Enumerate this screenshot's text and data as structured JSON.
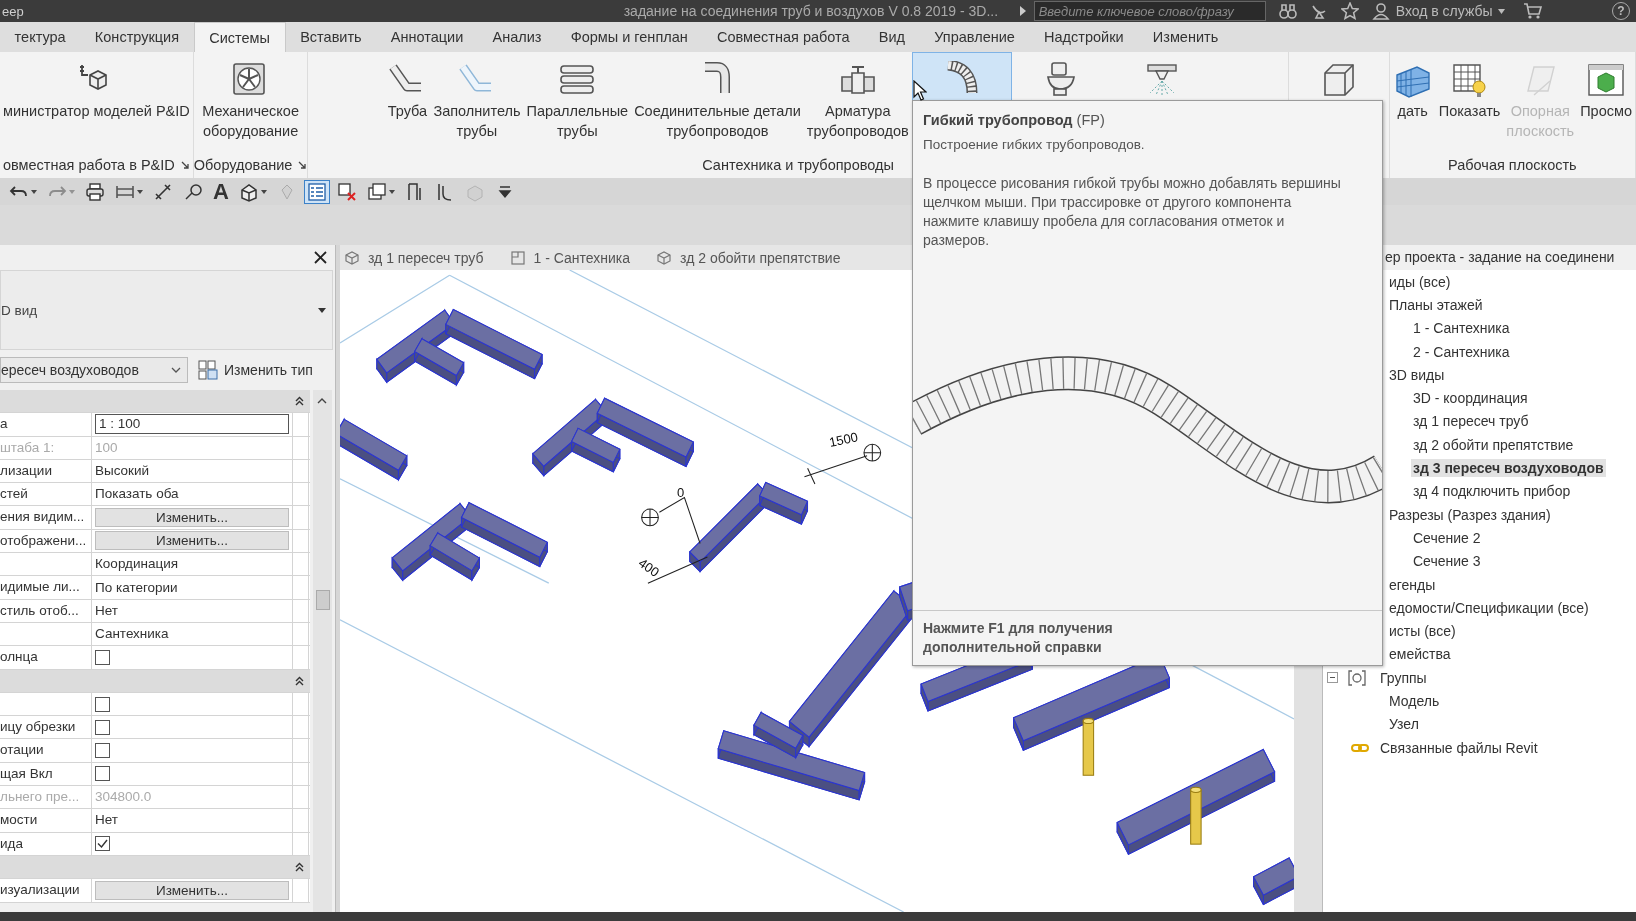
{
  "title_bar": {
    "app_name": "eep",
    "document_title": "задание на соединения труб и воздухов V 0.8  2019 - 3D...",
    "search": {
      "placeholder": "Введите ключевое слово/фразу"
    },
    "sign_in": "Вход в службы",
    "help": "?"
  },
  "ribbon_tabs": [
    {
      "label": "тектура",
      "selected": false
    },
    {
      "label": "Конструкция",
      "selected": false
    },
    {
      "label": "Системы",
      "selected": true
    },
    {
      "label": "Вставить",
      "selected": false
    },
    {
      "label": "Аннотации",
      "selected": false
    },
    {
      "label": "Анализ",
      "selected": false
    },
    {
      "label": "Формы и генплан",
      "selected": false
    },
    {
      "label": "Совместная работа",
      "selected": false
    },
    {
      "label": "Вид",
      "selected": false
    },
    {
      "label": "Управление",
      "selected": false
    },
    {
      "label": "Надстройки",
      "selected": false
    },
    {
      "label": "Изменить",
      "selected": false
    }
  ],
  "ribbon_panels": [
    {
      "title": "овместная работа в P&ID",
      "launcher": true,
      "buttons": [
        {
          "kind": "pid",
          "label": "министратор моделей P&ID",
          "disabled": false,
          "highlighted": false
        }
      ]
    },
    {
      "title": "Оборудование",
      "launcher": true,
      "buttons": [
        {
          "kind": "fan",
          "label": "Механическое\nоборудование",
          "disabled": false,
          "highlighted": false
        }
      ]
    },
    {
      "title": "Сантехника и трубопроводы",
      "launcher": false,
      "buttons": [
        {
          "kind": "pipe",
          "label": "Труба",
          "disabled": false,
          "highlighted": false
        },
        {
          "kind": "pipe-fill",
          "label": "Заполнитель\nтрубы",
          "disabled": false,
          "highlighted": false
        },
        {
          "kind": "parallel",
          "label": "Параллельные\nтрубы",
          "disabled": false,
          "highlighted": false
        },
        {
          "kind": "fitting",
          "label": "Соединительные детали\nтрубопроводов",
          "disabled": false,
          "highlighted": false
        },
        {
          "kind": "valve",
          "label": "Арматура\nтрубопроводов",
          "disabled": false,
          "highlighted": false
        },
        {
          "kind": "flex",
          "disabled": false,
          "highlighted": true
        },
        {
          "kind": "toilet",
          "disabled": false,
          "highlighted": false
        },
        {
          "kind": "sprinkler",
          "disabled": false,
          "highlighted": false
        }
      ]
    },
    {
      "buttons": [
        {
          "kind": "box",
          "disabled": false,
          "highlighted": false
        }
      ]
    },
    {
      "title": "Рабочая плоскость",
      "launcher": false,
      "buttons": [
        {
          "kind": "grid",
          "label": "дать",
          "disabled": false,
          "highlighted": false
        },
        {
          "kind": "grid-bulb",
          "label": "Показать",
          "disabled": false,
          "highlighted": false
        },
        {
          "kind": "plane",
          "label": "Опорная\nплоскость",
          "disabled": true,
          "highlighted": false
        },
        {
          "kind": "viewer",
          "label": "Просмо",
          "disabled": false,
          "highlighted": false
        }
      ]
    }
  ],
  "quick_access": [
    {
      "kind": "undo",
      "dropdown": true,
      "disabled": false,
      "selected": false
    },
    {
      "kind": "redo",
      "dropdown": true,
      "disabled": true,
      "selected": false
    },
    {
      "kind": "print",
      "dropdown": false,
      "disabled": false,
      "selected": false
    },
    {
      "kind": "measure",
      "dropdown": true,
      "disabled": false,
      "selected": false
    },
    {
      "kind": "dimension",
      "dropdown": false,
      "disabled": false,
      "selected": false
    },
    {
      "kind": "tag",
      "dropdown": false,
      "disabled": false,
      "selected": false
    },
    {
      "kind": "text",
      "label": "A",
      "dropdown": false,
      "disabled": false,
      "selected": false
    },
    {
      "kind": "house",
      "dropdown": true,
      "disabled": false,
      "selected": false
    },
    {
      "kind": "pin",
      "dropdown": false,
      "disabled": true,
      "selected": false
    },
    {
      "kind": "list",
      "dropdown": false,
      "disabled": false,
      "selected": true
    },
    {
      "kind": "close-windows",
      "dropdown": false,
      "disabled": false,
      "selected": false
    },
    {
      "kind": "switch-windows",
      "dropdown": true,
      "disabled": false,
      "selected": false
    },
    {
      "kind": "section",
      "dropdown": false,
      "disabled": false,
      "selected": false
    },
    {
      "kind": "thin-lines",
      "dropdown": false,
      "disabled": false,
      "selected": false
    },
    {
      "kind": "cube",
      "dropdown": false,
      "disabled": true,
      "selected": false
    },
    {
      "kind": "customize",
      "dropdown": false,
      "disabled": false,
      "selected": false
    }
  ],
  "properties": {
    "type": "D вид",
    "instance": "ересеч воздуховодов",
    "edit_type": "Изменить тип",
    "rows": [
      {
        "kind": "group"
      },
      {
        "kind": "input",
        "label": "а",
        "value": "1 : 100",
        "disabled": false
      },
      {
        "kind": "text",
        "label": "штаба   1:",
        "value": "100",
        "disabled": true
      },
      {
        "kind": "text",
        "label": "лизации",
        "value": "Высокий",
        "disabled": false
      },
      {
        "kind": "text",
        "label": "стей",
        "value": "Показать оба",
        "disabled": false
      },
      {
        "kind": "button",
        "label": "ения видим...",
        "value": "Изменить...",
        "disabled": false
      },
      {
        "kind": "button",
        "label": "отображени...",
        "value": "Изменить...",
        "disabled": false
      },
      {
        "kind": "text",
        "value": "Координация",
        "disabled": false
      },
      {
        "kind": "text",
        "label": "идимые ли...",
        "value": "По категории",
        "disabled": false
      },
      {
        "kind": "text",
        "label": "стиль отоб...",
        "value": "Нет",
        "disabled": false
      },
      {
        "kind": "text",
        "value": "Сантехника",
        "disabled": false
      },
      {
        "kind": "checkbox",
        "label": "олнца",
        "checked": false,
        "disabled": false
      },
      {
        "kind": "group"
      },
      {
        "kind": "checkbox",
        "checked": false,
        "disabled": false
      },
      {
        "kind": "checkbox",
        "label": "ицу обрезки",
        "checked": false,
        "disabled": false
      },
      {
        "kind": "checkbox",
        "label": "отации",
        "checked": false,
        "disabled": false
      },
      {
        "kind": "checkbox",
        "label": "щая Вкл",
        "checked": false,
        "disabled": false
      },
      {
        "kind": "text",
        "label": "льнего пре...",
        "value": "304800.0",
        "disabled": true
      },
      {
        "kind": "text",
        "label": "мости",
        "value": "Нет",
        "disabled": false
      },
      {
        "kind": "checkbox",
        "label": "ида",
        "checked": true,
        "disabled": false
      },
      {
        "kind": "group"
      },
      {
        "kind": "button",
        "label": "изуализации",
        "value": "Изменить...",
        "disabled": false
      }
    ]
  },
  "view_tabs": [
    {
      "kind": "model",
      "label": "зд 1 пересеч труб"
    },
    {
      "kind": "plan",
      "label": "1 - Сантехника"
    },
    {
      "kind": "model",
      "label": "зд 2 обойти препятствие"
    }
  ],
  "canvas": {
    "dimension_labels": [
      "0",
      "1500",
      "400"
    ]
  },
  "tooltip": {
    "title": "**Гибкий трубопровод** (FP)",
    "summary": "Построение гибких трубопроводов.",
    "description": "В процессе рисования гибкой трубы можно добавлять вершины щелчком мыши. При трассировке от другого компонента нажмите клавишу пробела для согласования отметок и размеров.",
    "footer": "Нажмите F1 для получения\nдополнительной справки"
  },
  "project_browser": {
    "title": "ер проекта - задание на соединени",
    "items": [
      {
        "kind": "category",
        "label": "иды (все)",
        "selected": false,
        "children": [
          {
            "label": "Планы этажей",
            "selected": false,
            "children": [
              {
                "label": "1 - Сантехника",
                "selected": false
              },
              {
                "label": "2 - Сантехника",
                "selected": false
              }
            ]
          },
          {
            "label": "3D виды",
            "selected": false,
            "children": [
              {
                "label": "3D - координация",
                "selected": false
              },
              {
                "label": "зд 1 пересеч труб",
                "selected": false
              },
              {
                "label": "зд 2 обойти препятствие",
                "selected": false
              },
              {
                "label": "зд 3 пересеч воздуховодов",
                "selected": true
              },
              {
                "label": "зд 4 подключить прибор",
                "selected": false
              }
            ]
          },
          {
            "label": "Разрезы (Разрез здания)",
            "selected": false,
            "children": [
              {
                "label": "Сечение 2",
                "selected": false
              },
              {
                "label": "Сечение 3",
                "selected": false
              }
            ]
          }
        ]
      },
      {
        "kind": "category",
        "label": "егенды",
        "selected": false
      },
      {
        "kind": "category",
        "label": "едомости/Спецификации (все)",
        "selected": false
      },
      {
        "kind": "category",
        "label": "исты (все)",
        "selected": false
      },
      {
        "kind": "category",
        "label": "емейства",
        "selected": false
      },
      {
        "kind": "group",
        "label": "Группы",
        "selected": false,
        "children": [
          {
            "label": "Модель",
            "selected": false
          },
          {
            "label": "Узел",
            "selected": false
          }
        ]
      },
      {
        "kind": "link",
        "label": "Связанные файлы Revit",
        "selected": false
      }
    ]
  }
}
